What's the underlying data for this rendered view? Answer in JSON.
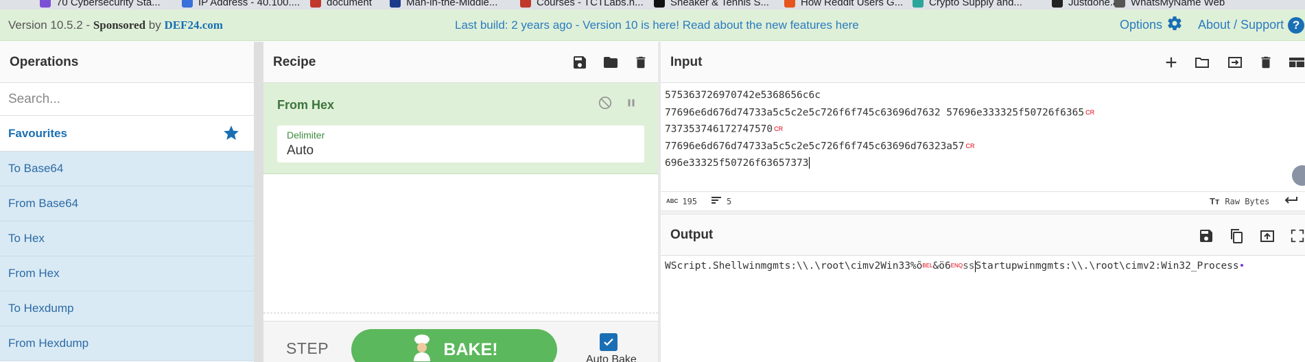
{
  "bookmarks": [
    {
      "label": "70 Cybersecurity Sta...",
      "color": "#7b4fd6"
    },
    {
      "label": "IP Address - 40.100....",
      "color": "#3b6fd9"
    },
    {
      "label": "document",
      "color": "#c0392b"
    },
    {
      "label": "Man-in-the-Middle...",
      "color": "#1b3a8a"
    },
    {
      "label": "Courses - TCTLabs.n...",
      "color": "#c0392b"
    },
    {
      "label": "Sneaker & Tennis S...",
      "color": "#111111"
    },
    {
      "label": "How Reddit Users G...",
      "color": "#e8541d"
    },
    {
      "label": "Crypto Supply and...",
      "color": "#2aa69b"
    },
    {
      "label": "Justdone.ai",
      "color": "#222222"
    },
    {
      "label": "WhatsMyName Web",
      "color": "#555555"
    }
  ],
  "banner": {
    "version_prefix": "Version 10.5.2 - ",
    "sponsored": "Sponsored",
    "by": " by ",
    "sponsor_link": "DEF24.com",
    "build_notice": "Last build: 2 years ago - Version 10 is here! Read about the new features here",
    "options_label": "Options",
    "about_label": "About / Support",
    "help_glyph": "?"
  },
  "operations": {
    "title": "Operations",
    "search_placeholder": "Search...",
    "favourites_label": "Favourites",
    "items": [
      "To Base64",
      "From Base64",
      "To Hex",
      "From Hex",
      "To Hexdump",
      "From Hexdump"
    ]
  },
  "recipe": {
    "title": "Recipe",
    "operation": {
      "name": "From Hex",
      "delimiter_label": "Delimiter",
      "delimiter_value": "Auto"
    },
    "step_label": "STEP",
    "bake_label": "BAKE!",
    "auto_bake_label": "Auto Bake",
    "auto_bake_checked": true
  },
  "input": {
    "title": "Input",
    "lines": [
      {
        "text": "575363726970742e5368656c6c",
        "cr": false
      },
      {
        "text": "77696e6d676d74733a5c5c2e5c726f6f745c63696d7632 57696e333325f50726f6365",
        "cr": true
      },
      {
        "text": "737353746172747570",
        "cr": true
      },
      {
        "text": "77696e6d676d74733a5c5c2e5c726f6f745c63696d76323a57",
        "cr": true
      },
      {
        "text": "696e33325f50726f63657373",
        "cr": false
      }
    ],
    "cr_label": "CR",
    "char_count": "195",
    "line_count": "5",
    "encoding": "Raw Bytes",
    "abc_glyph": "ABC"
  },
  "output": {
    "title": "Output",
    "part1": "WScript.Shellwinmgmts:\\\\.\\root\\cimv2Win33%õ",
    "bel": "BEL",
    "part2": "&ö6",
    "enq": "ENQ",
    "part3": "ss",
    "part4": "Startupwinmgmts:\\\\.\\root\\cimv2:Win32_Process",
    "trailing": "•"
  },
  "colors": {
    "banner_bg": "#dff0d8",
    "accent_blue": "#1a6fb4",
    "recipe_green": "#dff0d8",
    "bake_green": "#5cb85c",
    "op_item_bg": "#d9eaf4"
  }
}
